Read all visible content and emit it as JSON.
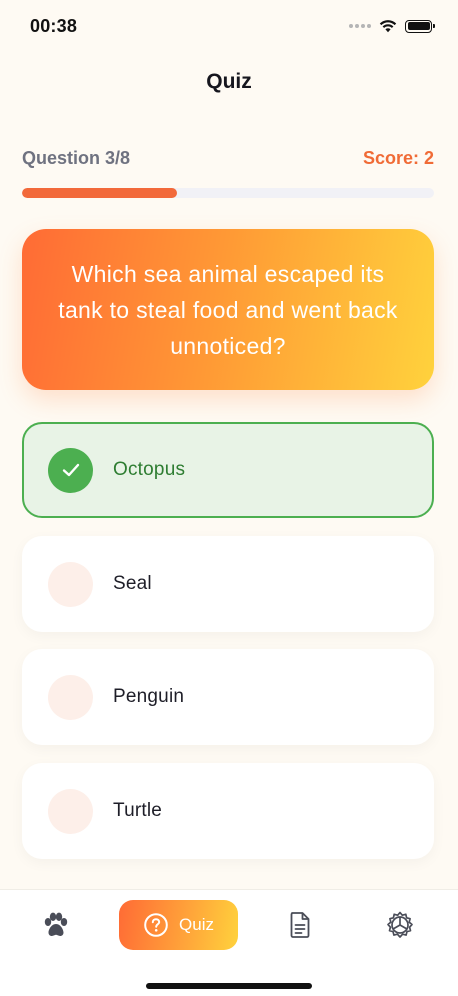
{
  "status_bar": {
    "time": "00:38"
  },
  "header": {
    "title": "Quiz"
  },
  "progress": {
    "question_label": "Question 3/8",
    "score_label": "Score: 2",
    "fraction": 0.375
  },
  "question": {
    "text": "Which sea animal escaped its tank to steal food and went back unnoticed?"
  },
  "options": [
    {
      "label": "Octopus",
      "state": "correct"
    },
    {
      "label": "Seal",
      "state": "default"
    },
    {
      "label": "Penguin",
      "state": "default"
    },
    {
      "label": "Turtle",
      "state": "default"
    }
  ],
  "bottom_nav": {
    "items": [
      {
        "icon": "paw-icon",
        "label": ""
      },
      {
        "icon": "question-circle-icon",
        "label": "Quiz",
        "active": true
      },
      {
        "icon": "document-icon",
        "label": ""
      },
      {
        "icon": "settings-icon",
        "label": ""
      }
    ]
  },
  "colors": {
    "accent_orange": "#f2693a",
    "accent_yellow": "#ffd23c",
    "correct_green": "#4caf50",
    "background": "#fefaf3"
  }
}
